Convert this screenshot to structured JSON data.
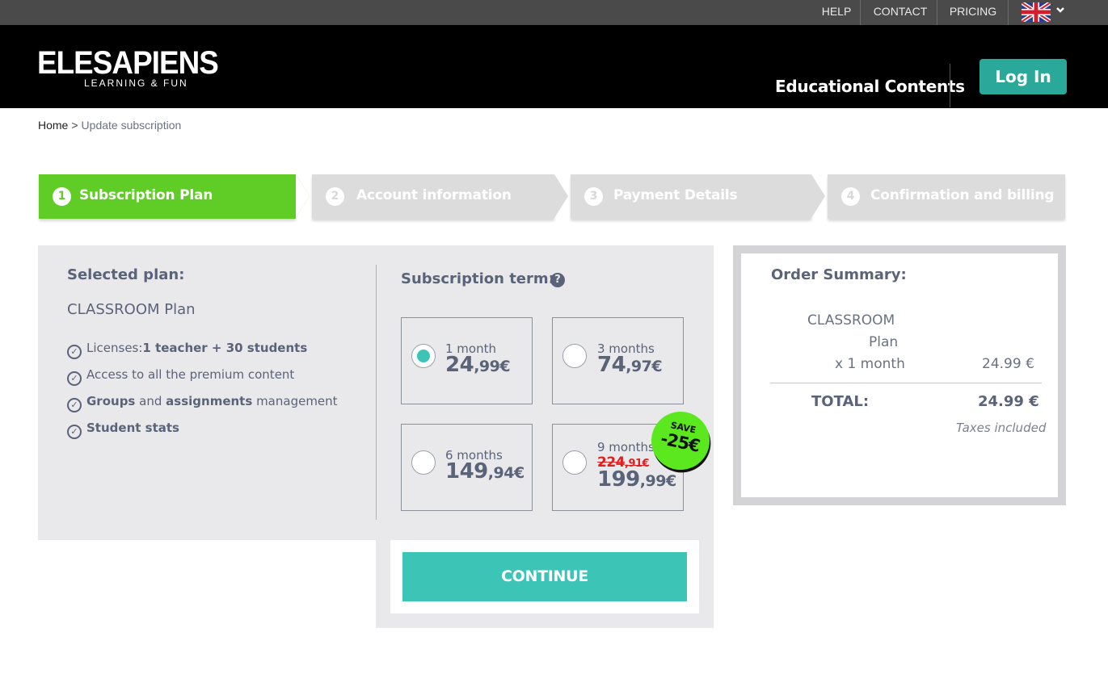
{
  "topbar": {
    "help": "HELP",
    "contact": "CONTACT",
    "pricing": "PRICING"
  },
  "header": {
    "logo": "ELESAPIENS",
    "logo_tagline": "LEARNING & FUN",
    "nav_educational": "Educational Contents",
    "login": "Log In"
  },
  "breadcrumb": {
    "home": "Home",
    "separator": ">",
    "current": "Update subscription"
  },
  "steps": [
    {
      "num": "1",
      "label": "Subscription Plan",
      "active": true
    },
    {
      "num": "2",
      "label": "Account information",
      "active": false
    },
    {
      "num": "3",
      "label": "Payment Details",
      "active": false
    },
    {
      "num": "4",
      "label": "Confirmation and billing",
      "active": false
    }
  ],
  "plan": {
    "selected_title": "Selected plan:",
    "name": "CLASSROOM Plan",
    "features": {
      "licenses_prefix": "Licenses:",
      "licenses_value": "1 teacher + 30 students",
      "premium": "Access to all the premium content",
      "groups": "Groups",
      "and": "and",
      "assignments": "assignments",
      "management": "management",
      "stats": "Student stats"
    }
  },
  "term": {
    "title": "Subscription term:",
    "options": [
      {
        "term": "1 month",
        "int": "24",
        "dec": ",99€",
        "selected": true
      },
      {
        "term": "3 months",
        "int": "74",
        "dec": ",97€",
        "selected": false
      },
      {
        "term": "6 months",
        "int": "149",
        "dec": ",94€",
        "selected": false
      },
      {
        "term": "9 months",
        "old_int": "224",
        "old_dec": ",91€",
        "int": "199",
        "dec": ",99€",
        "selected": false
      }
    ],
    "badge_save": "SAVE",
    "badge_amount": "-25€"
  },
  "continue": "CONTINUE",
  "summary": {
    "title": "Order Summary:",
    "plan_line1": "CLASSROOM",
    "plan_line2": "Plan",
    "qty": "x 1 month",
    "line_price": "24.99 €",
    "total_label": "TOTAL:",
    "total_value": "24.99 €",
    "tax_note": "Taxes included"
  },
  "colors": {
    "step_active": "#5fcd26",
    "step_inactive": "#dcdcdc",
    "accent": "#3cc4b6",
    "login": "#2aa89a",
    "badge": "#5ce81e",
    "strike": "#e02020"
  }
}
